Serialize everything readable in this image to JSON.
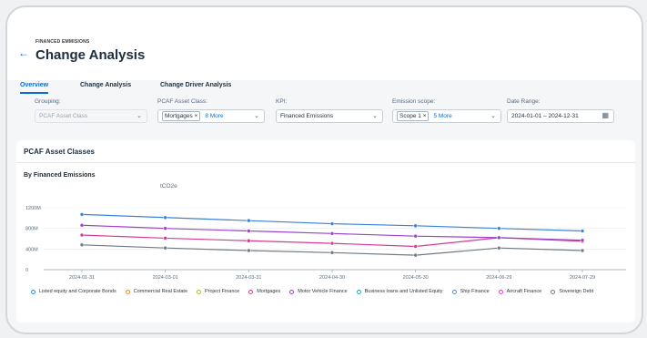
{
  "header": {
    "subtitle": "FINANCED EMMISIONS",
    "title": "Change Analysis"
  },
  "tabs": [
    {
      "label": "Overview",
      "active": true
    },
    {
      "label": "Change Analysis",
      "active": false
    },
    {
      "label": "Change Driver Analysis",
      "active": false
    }
  ],
  "filters": {
    "grouping": {
      "label": "Grouping:",
      "value": "PCAF Asset Class"
    },
    "asset_class": {
      "label": "PCAF Asset Class:",
      "token": "Mortgages",
      "more": "8 More"
    },
    "kpi": {
      "label": "KPI:",
      "value": "Financed Emissions"
    },
    "scope": {
      "label": "Emission scope:",
      "token": "Scope 1",
      "more": "5 More"
    },
    "date": {
      "label": "Date Range:",
      "value": "2024-01-01 – 2024-12-31"
    }
  },
  "card": {
    "title": "PCAF Asset Classes",
    "chart_title": "By Financed Emissions",
    "unit": "tCO2e"
  },
  "chart_data": {
    "type": "line",
    "x": [
      "2024-01-31",
      "2024-03-01",
      "2024-03-31",
      "2024-04-30",
      "2024-05-30",
      "2024-06-29",
      "2024-07-29"
    ],
    "ytick_labels": [
      "0",
      "400M",
      "800M",
      "1200M"
    ],
    "ylim": [
      0,
      1200
    ],
    "series": [
      {
        "name": "Listed equity and Corporate Bonds",
        "color": "#3b82d6",
        "values": [
          1070,
          1010,
          950,
          890,
          850,
          800,
          750
        ]
      },
      {
        "name": "Commercial Real Estate",
        "color": "#e98a2e",
        "values": [
          null,
          null,
          null,
          null,
          null,
          null,
          null
        ]
      },
      {
        "name": "Project Finance",
        "color": "#a9b536",
        "values": [
          null,
          null,
          null,
          null,
          null,
          null,
          null
        ]
      },
      {
        "name": "Mortgages",
        "color": "#d63a93",
        "values": [
          670,
          610,
          560,
          510,
          450,
          620,
          550
        ]
      },
      {
        "name": "Motor Vehicle Finance",
        "color": "#9b43c9",
        "values": [
          860,
          800,
          750,
          700,
          650,
          620,
          570
        ]
      },
      {
        "name": "Business loans and Unlisted Equity",
        "color": "#2aa8c4",
        "values": [
          null,
          null,
          null,
          null,
          null,
          null,
          null
        ]
      },
      {
        "name": "Ship Finance",
        "color": "#4d8fe0",
        "values": [
          null,
          null,
          null,
          null,
          null,
          null,
          null
        ]
      },
      {
        "name": "Aircraft Finance",
        "color": "#d24ac2",
        "values": [
          null,
          null,
          null,
          null,
          null,
          null,
          null
        ]
      },
      {
        "name": "Sovereign Debt",
        "color": "#6f7a85",
        "values": [
          480,
          420,
          370,
          330,
          280,
          420,
          370
        ]
      }
    ]
  }
}
